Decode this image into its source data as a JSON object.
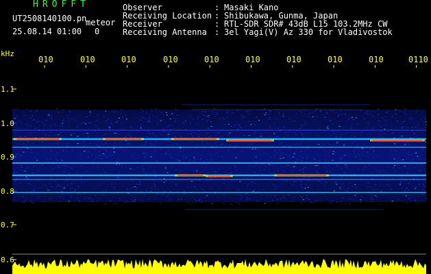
{
  "header": {
    "brand": "HROFFT",
    "filename": "UT2508140100.pn",
    "mode": "meteor",
    "datetime": "25.08.14 01:00",
    "count": "0",
    "labels": {
      "observer": "Observer",
      "location": "Receiving Location",
      "receiver": "Receiver",
      "antenna": "Receiving Antenna"
    },
    "separator": ":",
    "values": {
      "observer": "Masaki Kano",
      "location": "Shibukawa, Gunma, Japan",
      "receiver": "RTL-SDR SDR# 43dB L15 103.2MHz CW",
      "antenna": "3el Yagi(V) Az 330 for Vladivostok"
    }
  },
  "axes": {
    "y_unit": "kHz",
    "y_ticks": [
      "1.1",
      "1.0",
      "0.9",
      "0.8",
      "0.7",
      "0.6"
    ],
    "x_ticks": [
      "010",
      "010",
      "010",
      "010",
      "010",
      "010",
      "010",
      "010",
      "010",
      "0110"
    ]
  },
  "colors": {
    "background": "#000000",
    "text": "#ffffff",
    "title": "#33ff33",
    "tick": "#ffff44",
    "power_bar": "#ffff00",
    "spectrogram_low": "#0a1aa0",
    "spectrogram_mid": "#22c8ff",
    "spectrogram_high": "#ff3322"
  }
}
